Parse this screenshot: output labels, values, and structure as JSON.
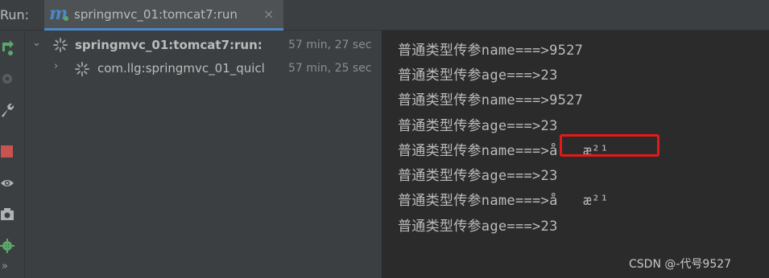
{
  "header": {
    "run_label": "Run:",
    "tab": {
      "icon_letter": "m",
      "title": "springmvc_01:tomcat7:run",
      "close": "×"
    }
  },
  "toolbar": {
    "icons": [
      "rerun-icon",
      "debug-icon",
      "wrench-icon",
      "stop-icon",
      "eye-icon",
      "camera-icon",
      "settings-gear-icon",
      "more-icon"
    ],
    "more_glyph": "»"
  },
  "tree": {
    "root": {
      "chevron": "⌄",
      "name": "springmvc_01:tomcat7:run:",
      "time": "57 min, 27 sec"
    },
    "child": {
      "chevron": "›",
      "name": "com.llg:springmvc_01_quicl",
      "time": "57 min, 25 sec"
    }
  },
  "console": {
    "lines": [
      "普通类型传参name===>9527",
      "普通类型传参age===>23",
      "普通类型传参name===>9527",
      "普通类型传参age===>23",
      "普通类型传参name===>å   æ²¹",
      "普通类型传参age===>23",
      "普通类型传参name===>å   æ²¹",
      "普通类型传参age===>23"
    ]
  },
  "watermark": "CSDN @-代号9527",
  "colors": {
    "accent": "#4a88c7",
    "running": "#59a869",
    "stop": "#c75450",
    "highlight": "#e81818"
  }
}
